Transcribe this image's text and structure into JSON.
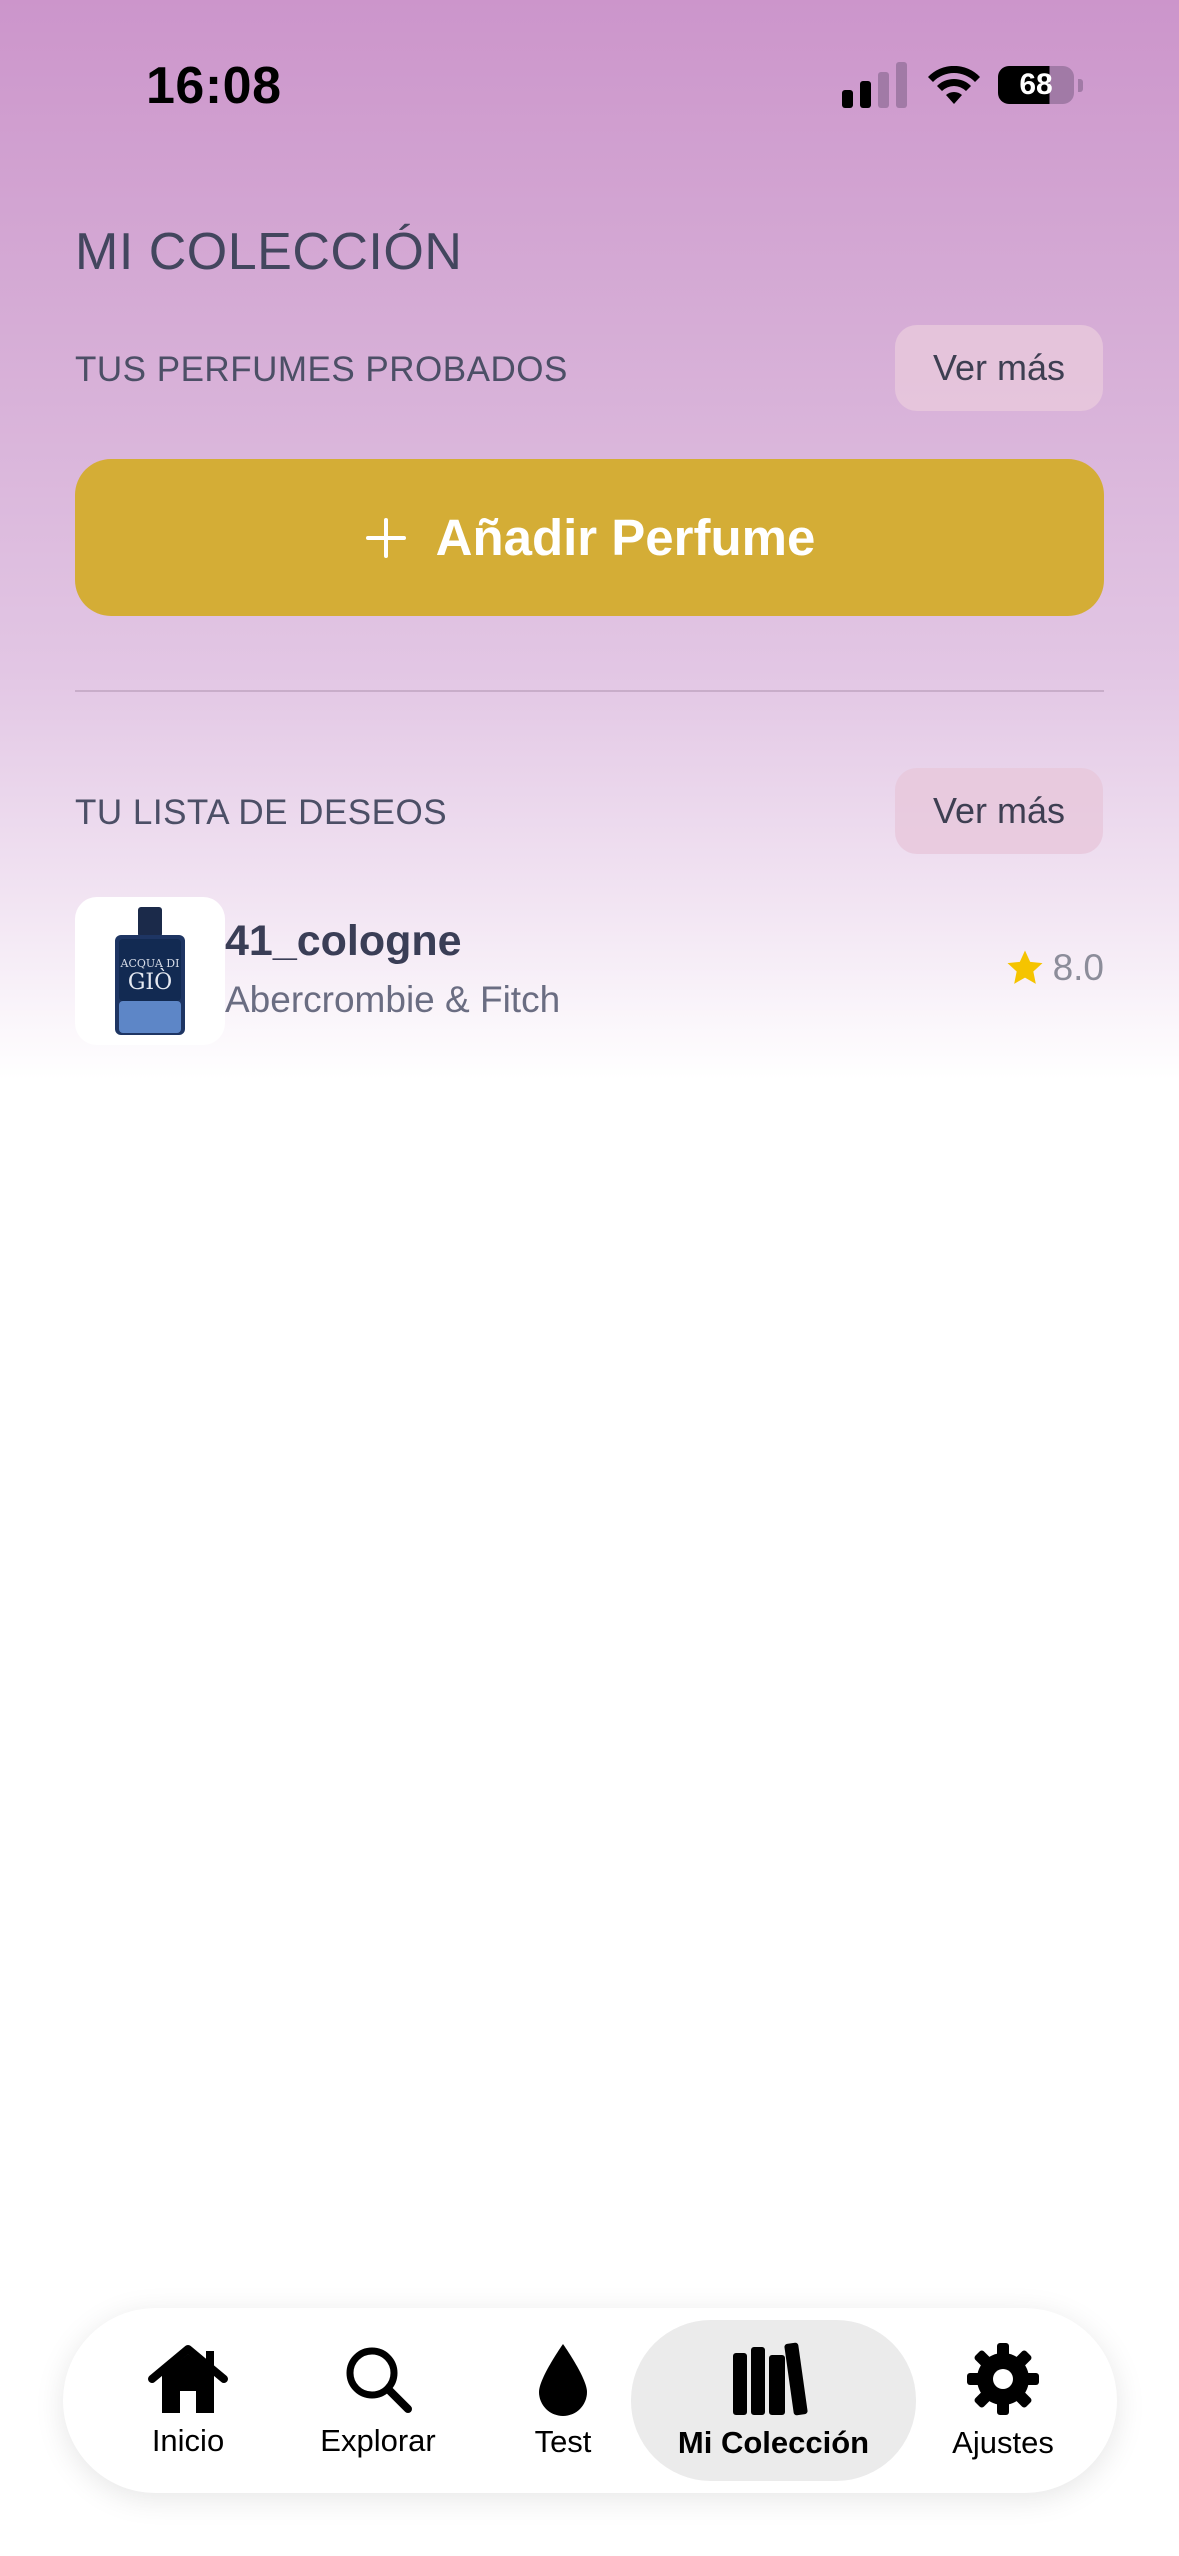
{
  "status_bar": {
    "time": "16:08",
    "battery": "68",
    "signal_icon": "cellular-signal-icon",
    "wifi_icon": "wifi-icon"
  },
  "page": {
    "title": "MI COLECCIÓN"
  },
  "tried_section": {
    "label": "TUS PERFUMES PROBADOS",
    "more_label": "Ver más"
  },
  "add_button": {
    "label": "Añadir Perfume",
    "icon": "plus-icon",
    "color": "#d4ad36"
  },
  "wishlist_section": {
    "label": "TU LISTA DE DESEOS",
    "more_label": "Ver más",
    "items": [
      {
        "name": "41_cologne",
        "brand": "Abercrombie & Fitch",
        "rating": "8.0",
        "rating_icon": "star-icon",
        "thumbnail": "perfume-bottle-image"
      }
    ]
  },
  "tab_bar": {
    "active": "Mi Colección",
    "tabs": [
      {
        "label": "Inicio",
        "icon": "home-icon"
      },
      {
        "label": "Explorar",
        "icon": "search-icon"
      },
      {
        "label": "Test",
        "icon": "drop-icon"
      },
      {
        "label": "Mi Colección",
        "icon": "books-icon"
      },
      {
        "label": "Ajustes",
        "icon": "gear-icon"
      }
    ]
  },
  "colors": {
    "accent": "#d4ad36",
    "star": "#f5c400",
    "gradient_top": "#cc95cb"
  }
}
